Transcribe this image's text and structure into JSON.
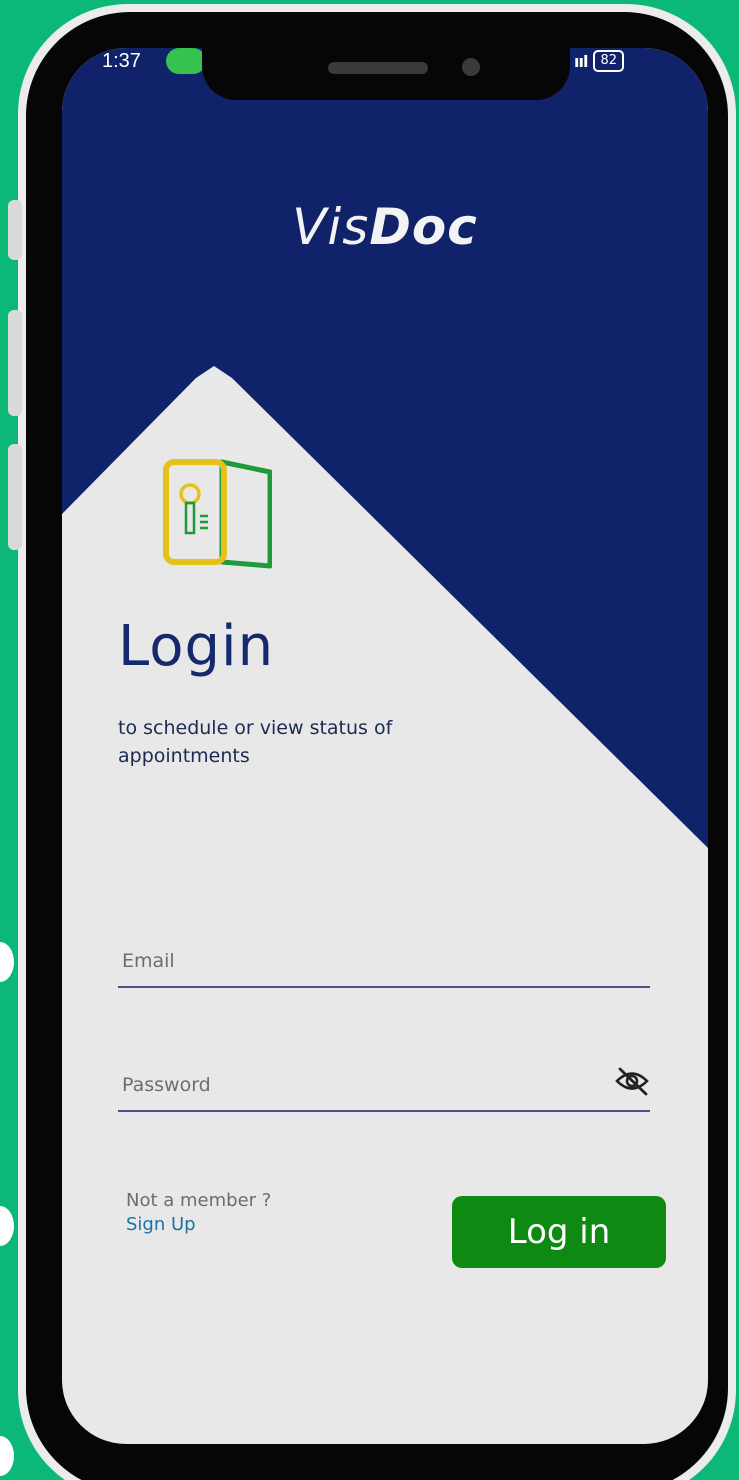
{
  "status_bar": {
    "time": "1:37",
    "signal": "ııl",
    "battery": "82"
  },
  "app": {
    "title_light": "Vis",
    "title_bold": "Doc"
  },
  "login": {
    "heading": "Login",
    "subtitle": "to schedule or view status of appointments"
  },
  "form": {
    "email_placeholder": "Email",
    "email_value": "",
    "password_placeholder": "Password",
    "password_value": ""
  },
  "footer": {
    "member_text": "Not a member ?",
    "signup_label": "Sign Up",
    "login_button_label": "Log in"
  },
  "colors": {
    "background": "#0cb877",
    "header_navy": "#10236a",
    "screen_bg": "#e8e8e8",
    "heading_text": "#142a6c",
    "button_green": "#0e8a13",
    "link_blue": "#1874a8",
    "icon_yellow": "#e4c21b",
    "icon_green": "#1e9a3a"
  },
  "icons": {
    "login_illustration": "key-door-icon",
    "password_toggle": "eye-off-icon"
  }
}
